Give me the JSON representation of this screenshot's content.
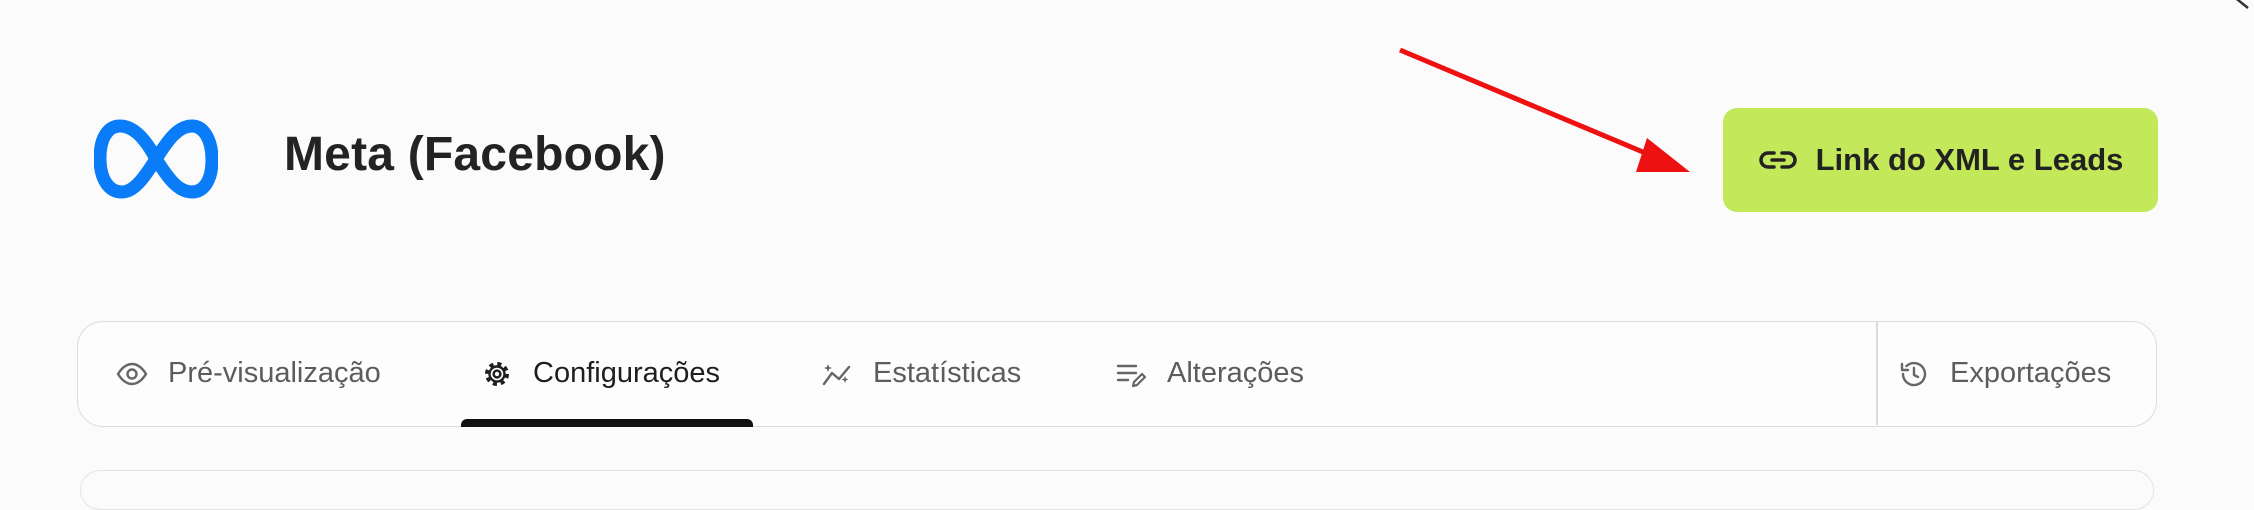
{
  "header": {
    "title": "Meta (Facebook)"
  },
  "actions": {
    "xml_leads_label": "Link do XML e Leads"
  },
  "tabs": [
    {
      "label": "Pré-visualização",
      "icon": "eye-icon"
    },
    {
      "label": "Configurações",
      "icon": "gear-icon",
      "active": true
    },
    {
      "label": "Estatísticas",
      "icon": "chart-trend-icon"
    },
    {
      "label": "Alterações",
      "icon": "edit-list-icon"
    },
    {
      "label": "Exportações",
      "icon": "history-icon"
    }
  ],
  "colors": {
    "accent": "#c3e85a",
    "meta_blue": "#0a7cf7",
    "annotation_arrow": "#ee1111"
  }
}
